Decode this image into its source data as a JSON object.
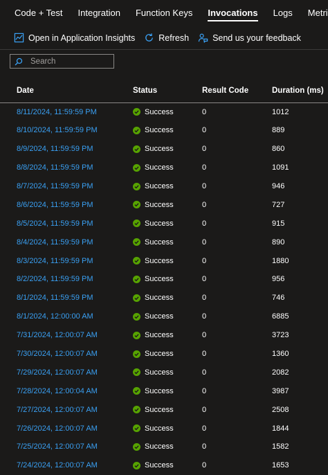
{
  "tabs": [
    {
      "label": "Code + Test",
      "active": false
    },
    {
      "label": "Integration",
      "active": false
    },
    {
      "label": "Function Keys",
      "active": false
    },
    {
      "label": "Invocations",
      "active": true
    },
    {
      "label": "Logs",
      "active": false
    },
    {
      "label": "Metrics",
      "active": false
    }
  ],
  "toolbar": {
    "insights_label": "Open in Application Insights",
    "refresh_label": "Refresh",
    "feedback_label": "Send us your feedback"
  },
  "search": {
    "placeholder": "Search",
    "value": ""
  },
  "table": {
    "headers": {
      "date": "Date",
      "status": "Status",
      "result_code": "Result Code",
      "duration": "Duration (ms)"
    },
    "rows": [
      {
        "date": "8/11/2024, 11:59:59 PM",
        "status": "Success",
        "result_code": "0",
        "duration": "1012"
      },
      {
        "date": "8/10/2024, 11:59:59 PM",
        "status": "Success",
        "result_code": "0",
        "duration": "889"
      },
      {
        "date": "8/9/2024, 11:59:59 PM",
        "status": "Success",
        "result_code": "0",
        "duration": "860"
      },
      {
        "date": "8/8/2024, 11:59:59 PM",
        "status": "Success",
        "result_code": "0",
        "duration": "1091"
      },
      {
        "date": "8/7/2024, 11:59:59 PM",
        "status": "Success",
        "result_code": "0",
        "duration": "946"
      },
      {
        "date": "8/6/2024, 11:59:59 PM",
        "status": "Success",
        "result_code": "0",
        "duration": "727"
      },
      {
        "date": "8/5/2024, 11:59:59 PM",
        "status": "Success",
        "result_code": "0",
        "duration": "915"
      },
      {
        "date": "8/4/2024, 11:59:59 PM",
        "status": "Success",
        "result_code": "0",
        "duration": "890"
      },
      {
        "date": "8/3/2024, 11:59:59 PM",
        "status": "Success",
        "result_code": "0",
        "duration": "1880"
      },
      {
        "date": "8/2/2024, 11:59:59 PM",
        "status": "Success",
        "result_code": "0",
        "duration": "956"
      },
      {
        "date": "8/1/2024, 11:59:59 PM",
        "status": "Success",
        "result_code": "0",
        "duration": "746"
      },
      {
        "date": "8/1/2024, 12:00:00 AM",
        "status": "Success",
        "result_code": "0",
        "duration": "6885"
      },
      {
        "date": "7/31/2024, 12:00:07 AM",
        "status": "Success",
        "result_code": "0",
        "duration": "3723"
      },
      {
        "date": "7/30/2024, 12:00:07 AM",
        "status": "Success",
        "result_code": "0",
        "duration": "1360"
      },
      {
        "date": "7/29/2024, 12:00:07 AM",
        "status": "Success",
        "result_code": "0",
        "duration": "2082"
      },
      {
        "date": "7/28/2024, 12:00:04 AM",
        "status": "Success",
        "result_code": "0",
        "duration": "3987"
      },
      {
        "date": "7/27/2024, 12:00:07 AM",
        "status": "Success",
        "result_code": "0",
        "duration": "2508"
      },
      {
        "date": "7/26/2024, 12:00:07 AM",
        "status": "Success",
        "result_code": "0",
        "duration": "1844"
      },
      {
        "date": "7/25/2024, 12:00:07 AM",
        "status": "Success",
        "result_code": "0",
        "duration": "1582"
      },
      {
        "date": "7/24/2024, 12:00:07 AM",
        "status": "Success",
        "result_code": "0",
        "duration": "1653"
      }
    ]
  },
  "icons": {
    "insights": "chart-icon",
    "refresh": "refresh-icon",
    "feedback": "feedback-person-icon",
    "search": "search-icon",
    "status": "success-check-icon"
  },
  "colors": {
    "link": "#3aa0f3",
    "success": "#57a300",
    "accent": "#0078d4"
  }
}
